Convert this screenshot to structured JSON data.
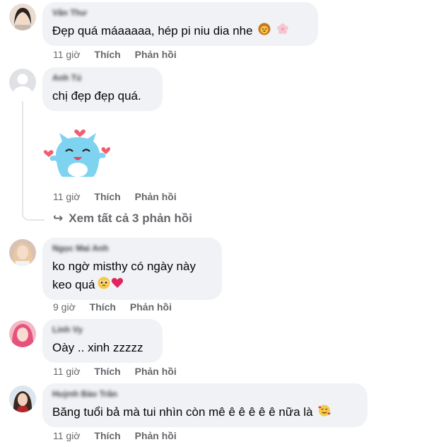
{
  "comments": [
    {
      "name": "Vân Thư",
      "text": "Đẹp quá máaaaaa, hép pi niu dia nhe",
      "time": "11 giờ",
      "like": "Thích",
      "reply": "Phản hồi"
    },
    {
      "name": "Anh Tú",
      "text": "chị đẹp đẹp quá.",
      "time": "11 giờ",
      "like": "Thích",
      "reply": "Phản hồi"
    },
    {
      "name": "Ngọc Mai Anh",
      "text_line1": "ko ngờ misthy có ngày này",
      "text_line2": "keo quá",
      "time": "9 giờ",
      "like": "Thích",
      "reply": "Phản hồi"
    },
    {
      "name": "Linh Vy",
      "text": "Oày .. xinh zzzzz",
      "time": "11 giờ",
      "like": "Thích",
      "reply": "Phản hồi"
    },
    {
      "name": "Huỳnh Bảo Trân",
      "text": "Băng tuổi bả mà tui nhìn còn mê ê ê ê ê ê nữa là",
      "time": "11 giờ",
      "like": "Thích",
      "reply": "Phản hồi"
    }
  ],
  "view_replies": {
    "arrow": "↪",
    "label": "Xem tất cả 3 phản hồi"
  },
  "colors": {
    "bubble": "#f0f2f5",
    "meta_text": "#65676b",
    "sticker_blue": "#7ed3f0",
    "heart": "#f25c6e"
  },
  "icons": [
    "user-avatar",
    "default-avatar",
    "sticker-blue-cat-hearts",
    "emoji-lion",
    "emoji-blossom",
    "emoji-pleading-face",
    "emoji-red-heart",
    "emoji-smiling-face-with-hearts"
  ]
}
